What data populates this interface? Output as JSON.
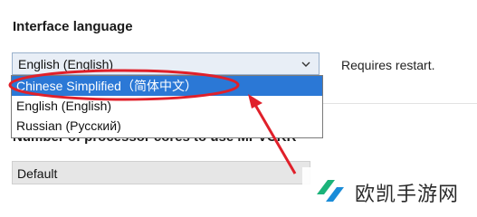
{
  "section": {
    "title": "Interface language"
  },
  "language_select": {
    "value": "English (English)",
    "note": "Requires restart.",
    "options": [
      "Chinese Simplified（简体中文）",
      "English (English)",
      "Russian (Русский)"
    ]
  },
  "processor": {
    "label": "Number of processor cores to use MPVCKR",
    "value": "Default"
  },
  "watermark": {
    "text": "欧凯手游网"
  },
  "colors": {
    "highlight": "#2b78d6",
    "annotation": "#e0202a"
  }
}
